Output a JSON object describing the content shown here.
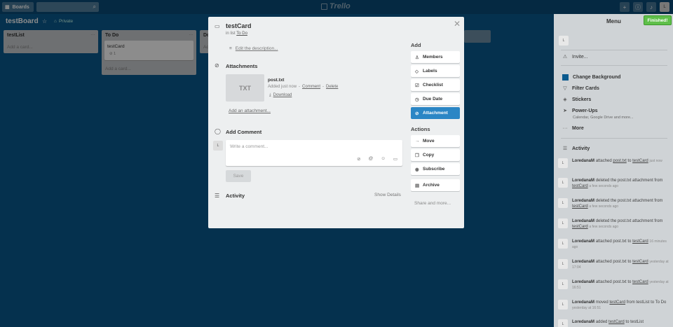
{
  "topbar": {
    "boards_label": "Boards",
    "logo_text": "Trello",
    "avatar_initial": "L"
  },
  "board": {
    "title": "testBoard",
    "visibility": "Private"
  },
  "lists": [
    {
      "title": "testList",
      "add_card": "Add a card..."
    },
    {
      "title": "To Do",
      "card_title": "testCard",
      "card_badge": "1",
      "add_card": "Add a card..."
    },
    {
      "title": "Do",
      "add_card": "Ad"
    }
  ],
  "menu": {
    "title": "Menu",
    "finished": "Finished!",
    "avatar_initial": "L",
    "invite": "Invite...",
    "items": [
      {
        "label": "Change Background"
      },
      {
        "label": "Filter Cards"
      },
      {
        "label": "Stickers"
      },
      {
        "label": "Power-Ups",
        "sub": "Calendar, Google Drive and more..."
      },
      {
        "label": "More"
      }
    ],
    "activity_title": "Activity",
    "activity": [
      {
        "user": "LoredanaM",
        "pre": "attached",
        "link1": "post.txt",
        "mid": "to",
        "link2": "testCard",
        "post": "",
        "time": "just now"
      },
      {
        "user": "LoredanaM",
        "pre": "deleted the post.txt attachment from",
        "link1": "testCard",
        "mid": "",
        "link2": "",
        "post": "",
        "time": "a few seconds ago"
      },
      {
        "user": "LoredanaM",
        "pre": "deleted the post.txt attachment from",
        "link1": "testCard",
        "mid": "",
        "link2": "",
        "post": "",
        "time": "a few seconds ago"
      },
      {
        "user": "LoredanaM",
        "pre": "deleted the post.txt attachment from",
        "link1": "testCard",
        "mid": "",
        "link2": "",
        "post": "",
        "time": "a few seconds ago"
      },
      {
        "user": "LoredanaM",
        "pre": "attached post.txt to",
        "link1": "testCard",
        "mid": "",
        "link2": "",
        "post": "",
        "time": "16 minutes ago"
      },
      {
        "user": "LoredanaM",
        "pre": "attached post.txt to",
        "link1": "testCard",
        "mid": "",
        "link2": "",
        "post": "",
        "time": "yesterday at 17:04"
      },
      {
        "user": "LoredanaM",
        "pre": "attached post.txt to",
        "link1": "testCard",
        "mid": "",
        "link2": "",
        "post": "",
        "time": "yesterday at 16:51"
      },
      {
        "user": "LoredanaM",
        "pre": "moved",
        "link1": "testCard",
        "mid": "from testList to To Do",
        "link2": "",
        "post": "",
        "time": "yesterday at 16:51"
      },
      {
        "user": "LoredanaM",
        "pre": "added",
        "link1": "testCard",
        "mid": "to testList",
        "link2": "",
        "post": "",
        "time": ""
      }
    ]
  },
  "modal": {
    "card_title": "testCard",
    "in_list_prefix": "in list",
    "in_list_name": "To Do",
    "edit_description": "Edit the description...",
    "attachments_title": "Attachments",
    "attachment": {
      "thumb_text": "TXT",
      "file_name": "post.txt",
      "added": "Added just now",
      "comment": "Comment",
      "delete": "Delete",
      "download": "Download"
    },
    "add_attachment": "Add an attachment...",
    "add_comment_title": "Add Comment",
    "comment_avatar": "L",
    "comment_placeholder": "Write a comment...",
    "save": "Save",
    "activity_title": "Activity",
    "show_details": "Show Details",
    "add_title": "Add",
    "add_buttons": [
      "Members",
      "Labels",
      "Checklist",
      "Due Date",
      "Attachment"
    ],
    "actions_title": "Actions",
    "action_buttons": [
      "Move",
      "Copy",
      "Subscribe",
      "Archive"
    ],
    "share_more": "Share and more..."
  }
}
